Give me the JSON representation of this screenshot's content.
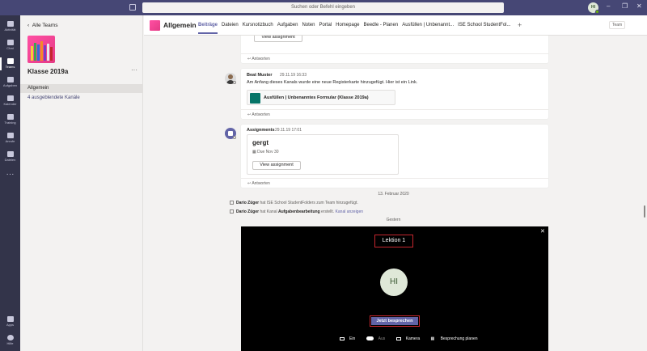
{
  "search": {
    "placeholder": "Suchen oder Befehl eingeben"
  },
  "user": {
    "initials": "HI"
  },
  "rail": [
    {
      "label": "Aktivität"
    },
    {
      "label": "Chat"
    },
    {
      "label": "Teams"
    },
    {
      "label": "Aufgaben"
    },
    {
      "label": "Kalender"
    },
    {
      "label": "Training"
    },
    {
      "label": "Anrufe"
    },
    {
      "label": "Dateien"
    }
  ],
  "rail_bottom": [
    {
      "label": "Apps"
    },
    {
      "label": "Hilfe"
    }
  ],
  "teampanel": {
    "back_label": "Alle Teams",
    "team_name": "Klasse 2019a",
    "more": "···",
    "active_channel": "Allgemein",
    "hidden_channels": "4 ausgeblendete Kanäle"
  },
  "header": {
    "title": "Allgemein",
    "tabs": [
      "Beiträge",
      "Dateien",
      "Kursnotizbuch",
      "Aufgaben",
      "Noten",
      "Portal",
      "Homepage",
      "Beedle - Planen",
      "Ausfüllen | Unbenannt...",
      "ISE School StudentFol..."
    ],
    "team_button": "Team"
  },
  "feed": {
    "reply_label": "Antworten",
    "post1": {
      "button": "View assignment"
    },
    "post2": {
      "author": "Beat Muster",
      "time": "29.11.19 16:33",
      "text": "Am Anfang dieses Kanals wurde eine neue Registerkarte hinzugefügt. Hier ist ein Link.",
      "file": "Ausfüllen | Unbenanntes Formular (Klasse 2019a)"
    },
    "post3": {
      "author": "Assignments",
      "time": "29.11.19 17:01",
      "title": "gergt",
      "due": "Due Nov 30",
      "button": "View assignment"
    },
    "date1": "13. Februar 2020",
    "sys1": {
      "name": "Dario Züger",
      "text": " hat ISE School StudentFolders zum Team hinzugefügt."
    },
    "sys2": {
      "name": "Dario Züger",
      "text": " hat Kanal ",
      "bold": "Aufgabenbearbeitung",
      "text2": " erstellt. ",
      "link": "Kanal anzeigen"
    },
    "date2": "Gestern"
  },
  "meeting": {
    "title": "Lektion 1",
    "avatar": "HI",
    "start_button": "Jetzt besprechen",
    "video_on": "Ein",
    "video_off": "Aus",
    "camera": "Kamera",
    "schedule": "Besprechung planen",
    "close": "✕"
  }
}
